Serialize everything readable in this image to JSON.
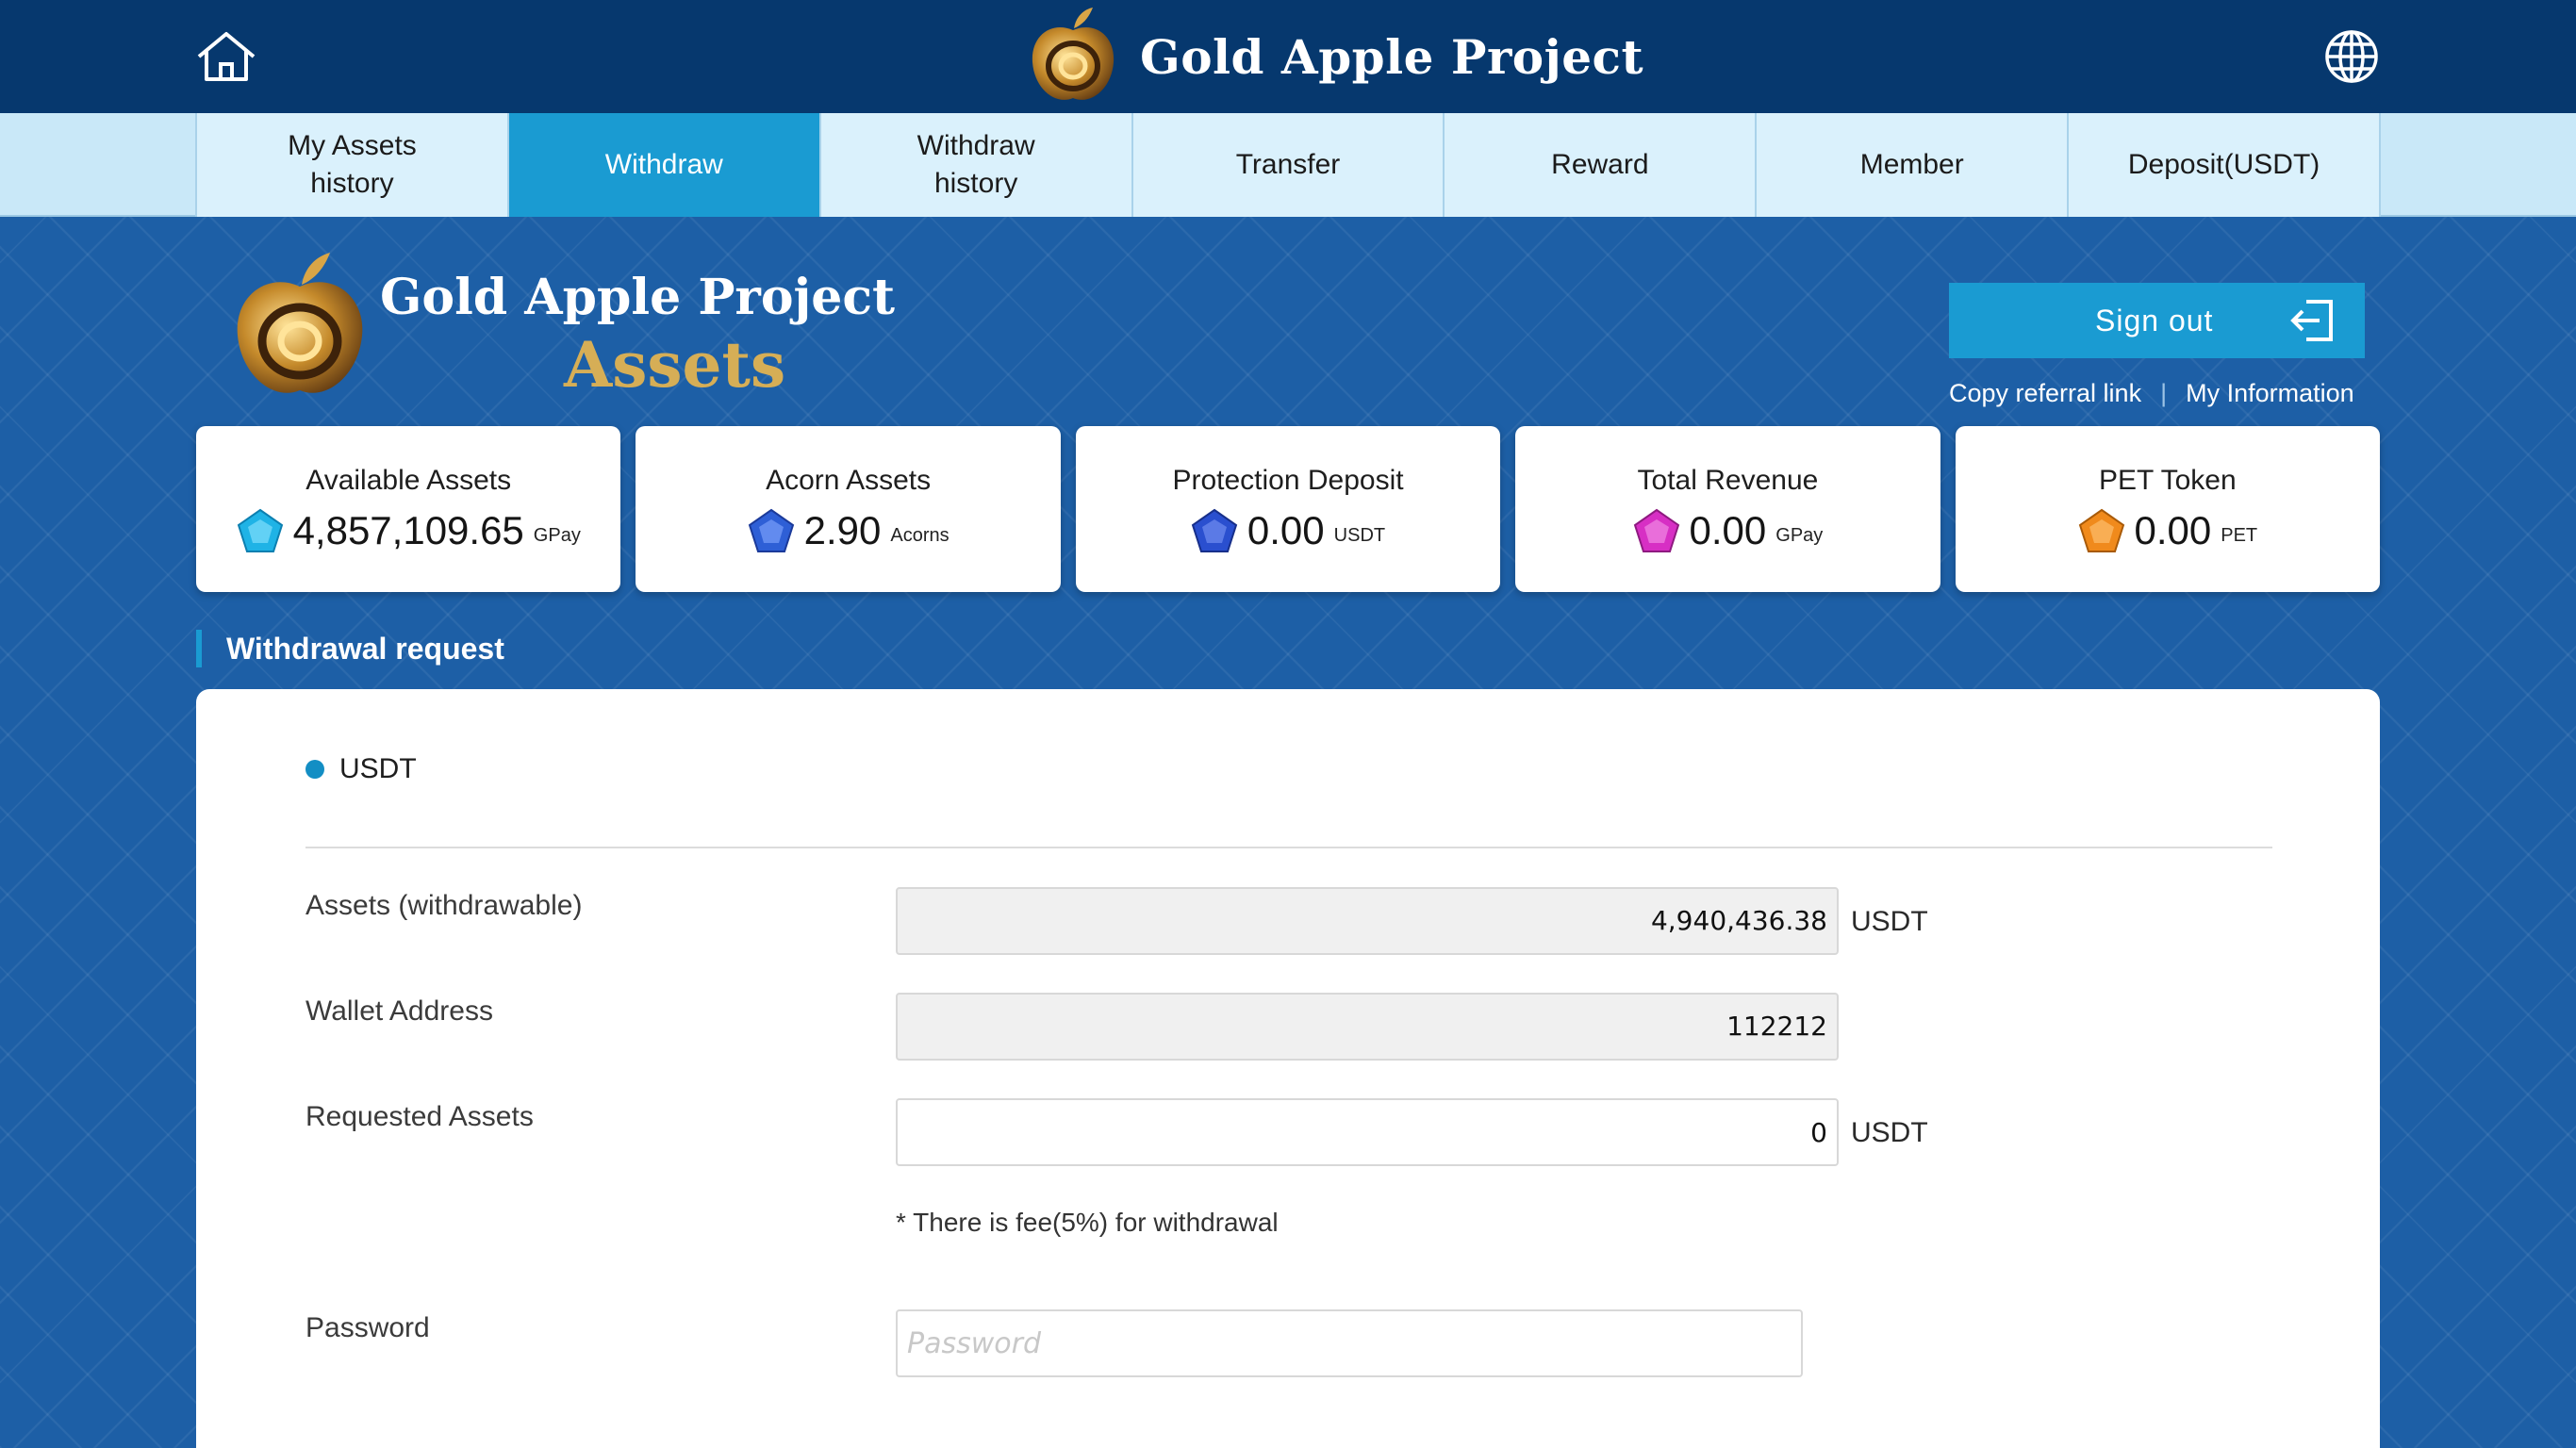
{
  "header": {
    "brand_title": "Gold Apple Project",
    "icons": {
      "home": "home-icon",
      "language": "globe-icon"
    }
  },
  "nav": {
    "items": [
      {
        "label": "My Assets\nhistory",
        "active": false
      },
      {
        "label": "Withdraw",
        "active": true
      },
      {
        "label": "Withdraw\nhistory",
        "active": false
      },
      {
        "label": "Transfer",
        "active": false
      },
      {
        "label": "Reward",
        "active": false
      },
      {
        "label": "Member",
        "active": false
      },
      {
        "label": "Deposit(USDT)",
        "active": false
      }
    ]
  },
  "page": {
    "title_line1": "Gold Apple Project",
    "title_line2": "Assets",
    "signout_label": "Sign out",
    "copy_referral_link": "Copy referral link",
    "separator": "|",
    "my_information": "My Information"
  },
  "cards": [
    {
      "title": "Available Assets",
      "value": "4,857,109.65",
      "unit": "GPay",
      "gem_color": "#1fb3e6",
      "icon": "gem-icon"
    },
    {
      "title": "Acorn Assets",
      "value": "2.90",
      "unit": "Acorns",
      "gem_color": "#2e5fd6",
      "icon": "gem-icon"
    },
    {
      "title": "Protection Deposit",
      "value": "0.00",
      "unit": "USDT",
      "gem_color": "#2a4fcf",
      "icon": "gem-icon"
    },
    {
      "title": "Total Revenue",
      "value": "0.00",
      "unit": "GPay",
      "gem_color": "#d72fc4",
      "icon": "gem-icon"
    },
    {
      "title": "PET Token",
      "value": "0.00",
      "unit": "PET",
      "gem_color": "#f08a1c",
      "icon": "gem-icon"
    }
  ],
  "form": {
    "section_title": "Withdrawal request",
    "currency_option": "USDT",
    "assets_label": "Assets (withdrawable)",
    "assets_value": "4,940,436.38",
    "assets_unit": "USDT",
    "wallet_label": "Wallet Address",
    "wallet_value": "112212",
    "requested_label": "Requested Assets",
    "requested_value": "0",
    "requested_unit": "USDT",
    "fee_note": "* There is fee(5%) for withdrawal",
    "password_label": "Password",
    "password_placeholder": "Password"
  },
  "colors": {
    "header_bg": "#06386e",
    "nav_active": "#1a9bd2",
    "accent_gold": "#d6ae56"
  }
}
